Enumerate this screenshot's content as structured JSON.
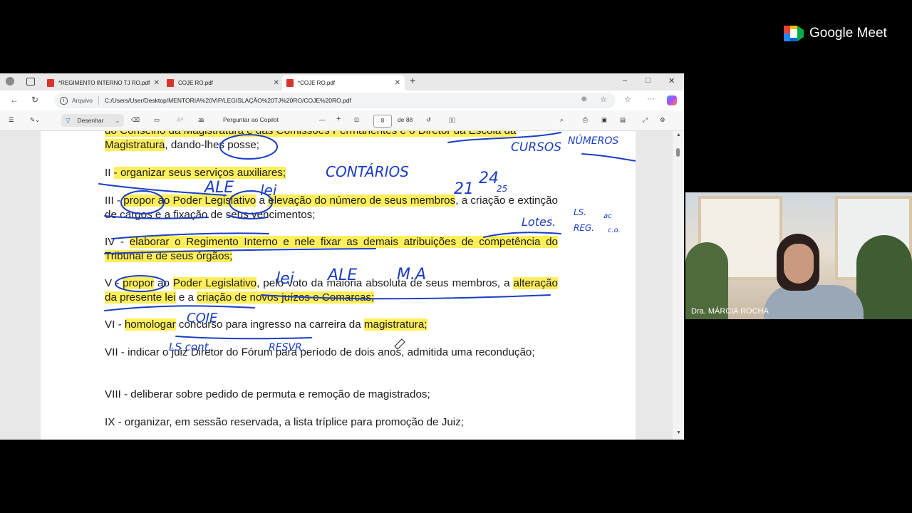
{
  "browser": {
    "tabs": [
      {
        "label": "*REGIMENTO INTERNO TJ RO.pdf",
        "active": false
      },
      {
        "label": "COJE RO.pdf",
        "active": false
      },
      {
        "label": "*COJE RO.pdf",
        "active": true
      }
    ],
    "new_tab_label": "+",
    "window_controls": {
      "minimize": "–",
      "maximize": "□",
      "close": "✕"
    },
    "address": {
      "site_label": "Arquivo",
      "url": "C:/Users/User/Desktop/MENTORIA%20VIP/LEGISLAÇÃO%20TJ%20RO/COJE%20RO.pdf"
    }
  },
  "pdf_toolbar": {
    "draw_label": "Desenhar",
    "copilot_label": "Perguntar ao Copilot",
    "page_current": "8",
    "page_total_label": "de 88"
  },
  "document": {
    "line_top_cut": "do Conselho da Magistratura e das Comissões Permanentes e o Diretor da Escola da",
    "p0_hl": "Magistratura",
    "p0_rest": ", dando-lhes posse;",
    "p2_prefix": "II ",
    "p2_hl": "- organizar seus serviços auxiliares;",
    "p3_prefix": "III - ",
    "p3_hl1": "propor ao Poder Legislativo",
    "p3_mid": " a ",
    "p3_hl2": "elevação do número de seus membros",
    "p3_rest": ", a criação e extinção de cargos e a fixação de seus vencimentos;",
    "p4_prefix": "IV - ",
    "p4_hl": "elaborar o Regimento Interno e nele fixar as demais atribuições de competência do Tribunal e de seus órgãos;",
    "p5_prefix": "V - ",
    "p5_hl1": "propor",
    "p5_mid1": " ao ",
    "p5_hl2": "Poder Legislativo",
    "p5_mid2": ", pelo voto da maioria absoluta de seus membros, a ",
    "p5_hl3": "alteração da presente lei",
    "p5_mid3": " e a ",
    "p5_hl4": "criação de novos juízos e Comarcas;",
    "p6_prefix": "VI - ",
    "p6_hl1": "homologar",
    "p6_mid": " concurso para ingresso na carreira da ",
    "p6_hl2": "magistratura;",
    "p7": "VII - indicar o juiz Diretor do Fórum para período de dois anos, admitida uma recondução;",
    "p8": "VIII - deliberar sobre pedido de permuta e remoção de magistrados;",
    "p9": "IX - organizar, em sessão reservada, a lista tríplice para promoção de Juiz;"
  },
  "annotations": {
    "cursos": "CURSOS",
    "numeros": "NÚMEROS",
    "cont": "CONTÁRIOS",
    "ale1": "ALE",
    "lei1": "lei",
    "n21": "21",
    "n24": "24",
    "n25": "25",
    "lotes": "Lotes.",
    "ls": "LS.",
    "reg": "REG.",
    "ac": "ac",
    "co": "c.o.",
    "lei2": "lei",
    "ale2": "ALE",
    "ma": "M.A",
    "coje": "COJE",
    "ls2": "LS cont.",
    "resvr": "RESVR."
  },
  "meet": {
    "brand": "Google Meet",
    "participant_name": "Dra. MÁRCIA ROCHA",
    "colors": {
      "green": "#00ac47",
      "blue": "#2684fc",
      "yellow": "#ffba00",
      "red": "#ea4335"
    }
  },
  "colors": {
    "highlight": "#ffef5a",
    "ink": "#1a3dc4"
  }
}
